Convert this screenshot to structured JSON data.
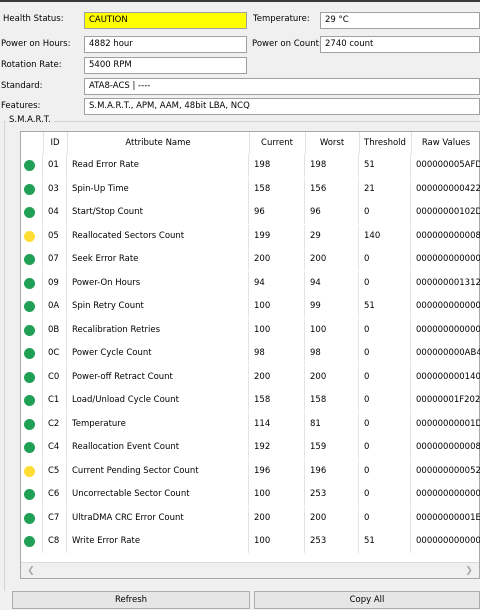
{
  "info": {
    "health_status_label": "Health Status:",
    "health_status_value": "CAUTION",
    "temperature_label": "Temperature:",
    "temperature_value": "29 °C",
    "power_on_hours_label": "Power on Hours:",
    "power_on_hours_value": "4882 hour",
    "power_on_count_label": "Power on Count:",
    "power_on_count_value": "2740 count",
    "rotation_rate_label": "Rotation Rate:",
    "rotation_rate_value": "5400 RPM",
    "standard_label": "Standard:",
    "standard_value": "ATA8-ACS | ----",
    "features_label": "Features:",
    "features_value": "S.M.A.R.T., APM, AAM, 48bit LBA, NCQ"
  },
  "smart": {
    "group_title": "S.M.A.R.T.",
    "columns": [
      "ID",
      "Attribute Name",
      "Current",
      "Worst",
      "Threshold",
      "Raw Values"
    ],
    "status_colors": {
      "good": "#1fa055",
      "caution": "#ffdd33"
    },
    "rows": [
      {
        "status": "good",
        "id": "01",
        "name": "Read Error Rate",
        "current": "198",
        "worst": "198",
        "threshold": "51",
        "raw": "000000005AFD"
      },
      {
        "status": "good",
        "id": "03",
        "name": "Spin-Up Time",
        "current": "158",
        "worst": "156",
        "threshold": "21",
        "raw": "000000000422"
      },
      {
        "status": "good",
        "id": "04",
        "name": "Start/Stop Count",
        "current": "96",
        "worst": "96",
        "threshold": "0",
        "raw": "00000000102D"
      },
      {
        "status": "caution",
        "id": "05",
        "name": "Reallocated Sectors Count",
        "current": "199",
        "worst": "29",
        "threshold": "140",
        "raw": "000000000008"
      },
      {
        "status": "good",
        "id": "07",
        "name": "Seek Error Rate",
        "current": "200",
        "worst": "200",
        "threshold": "0",
        "raw": "000000000000"
      },
      {
        "status": "good",
        "id": "09",
        "name": "Power-On Hours",
        "current": "94",
        "worst": "94",
        "threshold": "0",
        "raw": "000000001312"
      },
      {
        "status": "good",
        "id": "0A",
        "name": "Spin Retry Count",
        "current": "100",
        "worst": "99",
        "threshold": "51",
        "raw": "000000000000"
      },
      {
        "status": "good",
        "id": "0B",
        "name": "Recalibration Retries",
        "current": "100",
        "worst": "100",
        "threshold": "0",
        "raw": "000000000000"
      },
      {
        "status": "good",
        "id": "0C",
        "name": "Power Cycle Count",
        "current": "98",
        "worst": "98",
        "threshold": "0",
        "raw": "000000000AB4"
      },
      {
        "status": "good",
        "id": "C0",
        "name": "Power-off Retract Count",
        "current": "200",
        "worst": "200",
        "threshold": "0",
        "raw": "000000000140"
      },
      {
        "status": "good",
        "id": "C1",
        "name": "Load/Unload Cycle Count",
        "current": "158",
        "worst": "158",
        "threshold": "0",
        "raw": "00000001F202"
      },
      {
        "status": "good",
        "id": "C2",
        "name": "Temperature",
        "current": "114",
        "worst": "81",
        "threshold": "0",
        "raw": "00000000001D"
      },
      {
        "status": "good",
        "id": "C4",
        "name": "Reallocation Event Count",
        "current": "192",
        "worst": "159",
        "threshold": "0",
        "raw": "000000000008"
      },
      {
        "status": "caution",
        "id": "C5",
        "name": "Current Pending Sector Count",
        "current": "196",
        "worst": "196",
        "threshold": "0",
        "raw": "000000000052"
      },
      {
        "status": "good",
        "id": "C6",
        "name": "Uncorrectable Sector Count",
        "current": "100",
        "worst": "253",
        "threshold": "0",
        "raw": "000000000000"
      },
      {
        "status": "good",
        "id": "C7",
        "name": "UltraDMA CRC Error Count",
        "current": "200",
        "worst": "200",
        "threshold": "0",
        "raw": "00000000001E"
      },
      {
        "status": "good",
        "id": "C8",
        "name": "Write Error Rate",
        "current": "100",
        "worst": "253",
        "threshold": "51",
        "raw": "000000000000"
      }
    ]
  },
  "scroll": {
    "left_icon": "chevron-left-icon",
    "right_icon": "chevron-right-icon"
  },
  "buttons": {
    "refresh_label": "Refresh",
    "copy_all_label": "Copy All"
  }
}
